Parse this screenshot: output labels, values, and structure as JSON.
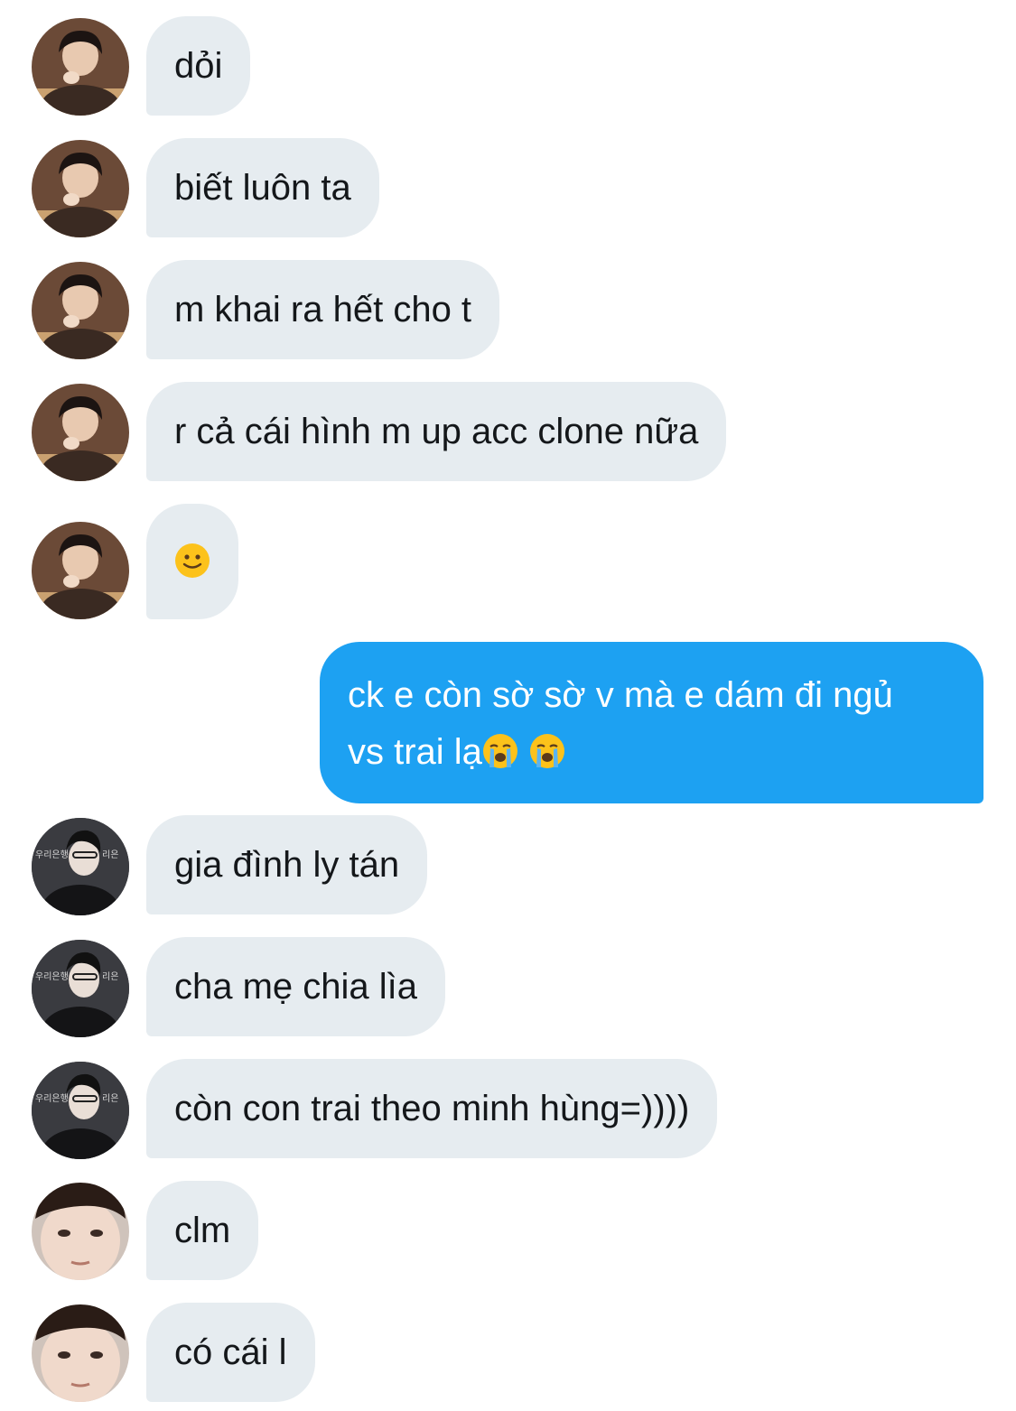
{
  "colors": {
    "received_bubble": "#e6ecf0",
    "received_text": "#14171a",
    "sent_bubble": "#1da1f2",
    "sent_text": "#ffffff"
  },
  "messages": [
    {
      "sender": "contact",
      "avatar": "avatar-a",
      "text": "dỏi"
    },
    {
      "sender": "contact",
      "avatar": "avatar-a",
      "text": "biết luôn ta"
    },
    {
      "sender": "contact",
      "avatar": "avatar-a",
      "text": "m khai ra hết cho t"
    },
    {
      "sender": "contact",
      "avatar": "avatar-a",
      "text": "r cả cái hình m up acc clone nữa"
    },
    {
      "sender": "contact",
      "avatar": "avatar-a",
      "emoji": "slightly-smiling-face-icon"
    },
    {
      "sender": "me",
      "line1": "ck e còn sờ sờ v mà e dám đi ngủ",
      "line2": "vs trai lạ",
      "emoji": "loudly-crying-face-icon"
    },
    {
      "sender": "contact",
      "avatar": "avatar-b",
      "text": "gia đình ly tán"
    },
    {
      "sender": "contact",
      "avatar": "avatar-b",
      "text": "cha mẹ chia lìa"
    },
    {
      "sender": "contact",
      "avatar": "avatar-b",
      "text": "còn con trai theo minh hùng=))))"
    },
    {
      "sender": "contact",
      "avatar": "avatar-c",
      "text": "clm"
    },
    {
      "sender": "contact",
      "avatar": "avatar-c",
      "text": "có cái l"
    }
  ]
}
